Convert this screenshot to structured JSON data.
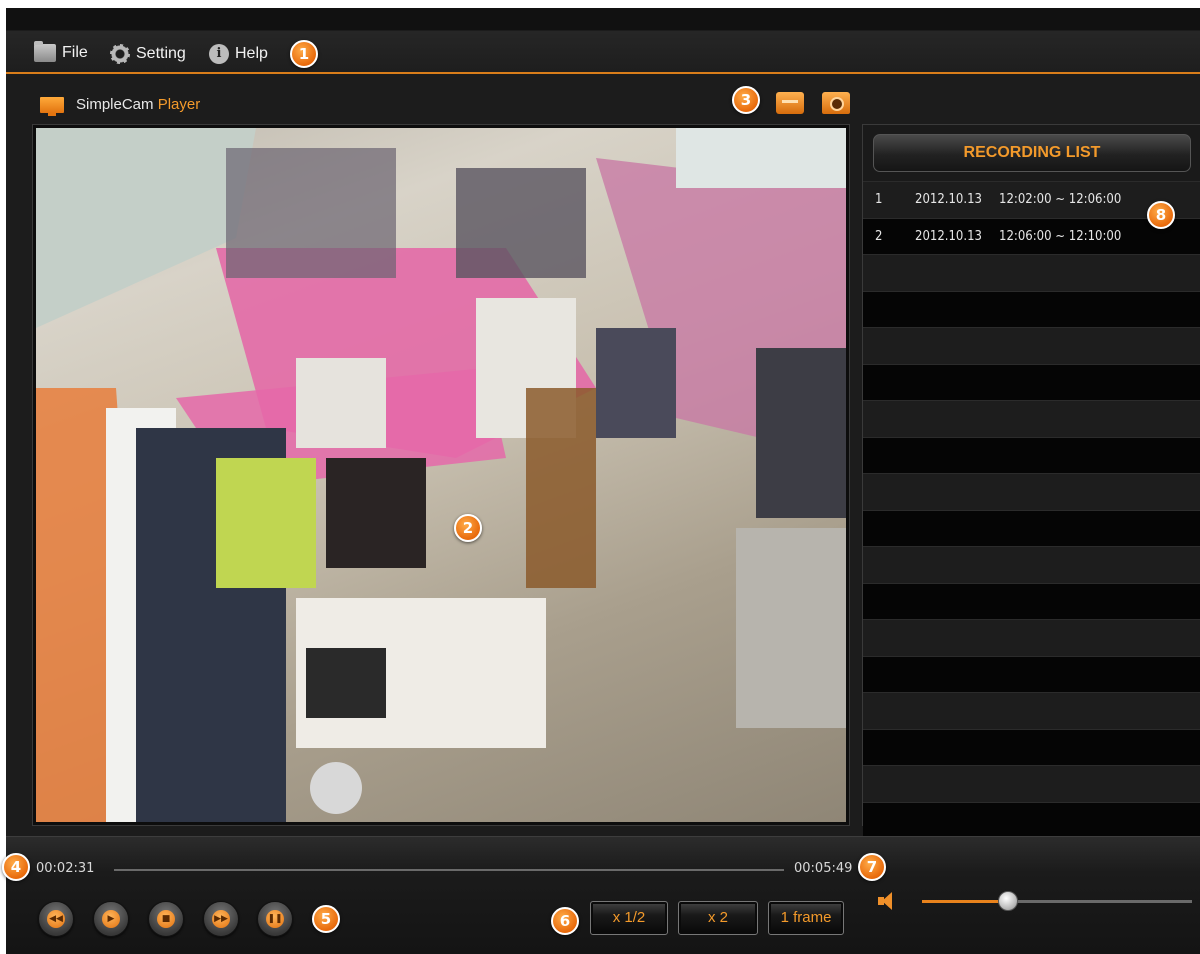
{
  "menu": {
    "items": [
      {
        "label": "File",
        "icon": "folder-icon"
      },
      {
        "label": "Setting",
        "icon": "gear-icon"
      },
      {
        "label": "Help",
        "icon": "info-icon"
      }
    ]
  },
  "player": {
    "brand_name": "SimpleCam ",
    "brand_accent": "Player",
    "tools": [
      "record-icon",
      "camera-icon"
    ]
  },
  "recording_list": {
    "title": "RECORDING LIST",
    "rows": [
      {
        "num": "1",
        "date": "2012.10.13",
        "time_range": "12:02:00 ~ 12:06:00"
      },
      {
        "num": "2",
        "date": "2012.10.13",
        "time_range": "12:06:00 ~ 12:10:00"
      }
    ]
  },
  "playback": {
    "current_time": "00:02:31",
    "total_time": "00:05:49",
    "buttons": [
      "rewind",
      "play",
      "stop",
      "fast-forward",
      "pause"
    ],
    "speed_buttons": [
      "x 1/2",
      "x 2",
      "1 frame"
    ],
    "volume_level": 0.32
  },
  "callouts": [
    "1",
    "2",
    "3",
    "4",
    "5",
    "6",
    "7",
    "8"
  ],
  "colors": {
    "accent": "#f39a2b",
    "background": "#1c1c1c"
  }
}
